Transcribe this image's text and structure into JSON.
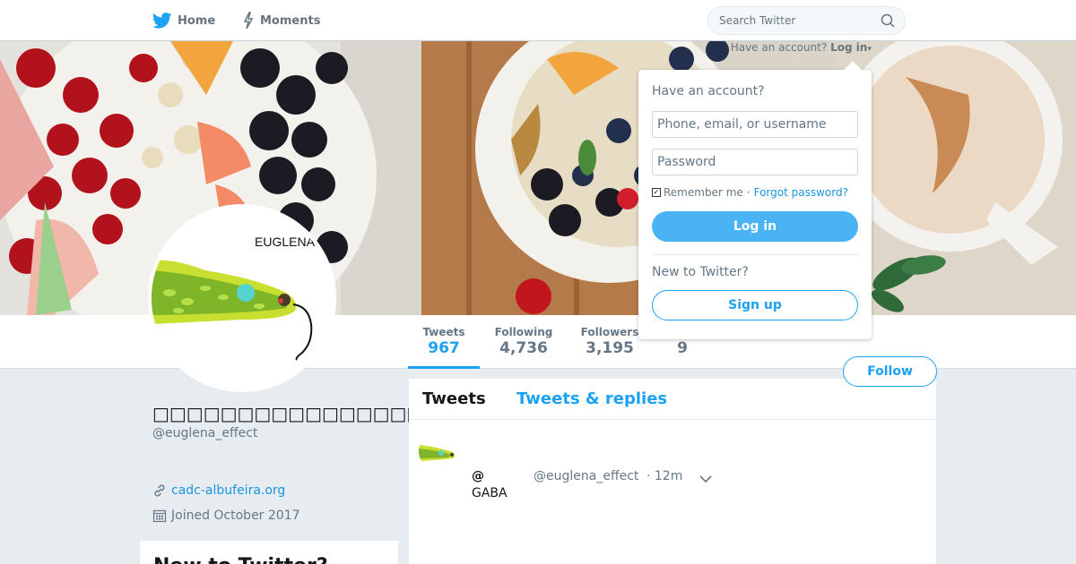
{
  "nav": {
    "home_label": "Home",
    "moments_label": "Moments",
    "search_placeholder": "Search Twitter"
  },
  "login_hint": {
    "prefix": "Have an account?",
    "link": "Log in"
  },
  "profile_nav": {
    "tweets_label": "Tweets",
    "tweets_value": "967",
    "following_label": "Following",
    "following_value": "4,736",
    "followers_label": "Followers",
    "followers_value": "3,195",
    "likes_value": "9",
    "follow_button": "Follow"
  },
  "profile": {
    "name": "□□□□□□□□□□□□□□□□□@□□",
    "handle": "@euglena_effect",
    "url": "cadc-albufeira.org",
    "joined": "Joined October 2017",
    "avatar_text": "EUGLENA"
  },
  "sidebar_card": {
    "title": "New to Twitter?"
  },
  "timeline": {
    "tab_tweets": "Tweets",
    "tab_replies": "Tweets & replies",
    "tweet": {
      "name": "@",
      "handle": "@euglena_effect",
      "time": "· 12m",
      "text": "GABA"
    }
  },
  "login_dropdown": {
    "header": "Have an account?",
    "username_placeholder": "Phone, email, or username",
    "password_placeholder": "Password",
    "remember_label": "Remember me",
    "separator": "·",
    "forgot_label": "Forgot password?",
    "login_button": "Log in",
    "new_to_label": "New to Twitter?",
    "signup_button": "Sign up"
  },
  "colors": {
    "accent": "#1da1f2",
    "background": "#e6ecf0"
  }
}
